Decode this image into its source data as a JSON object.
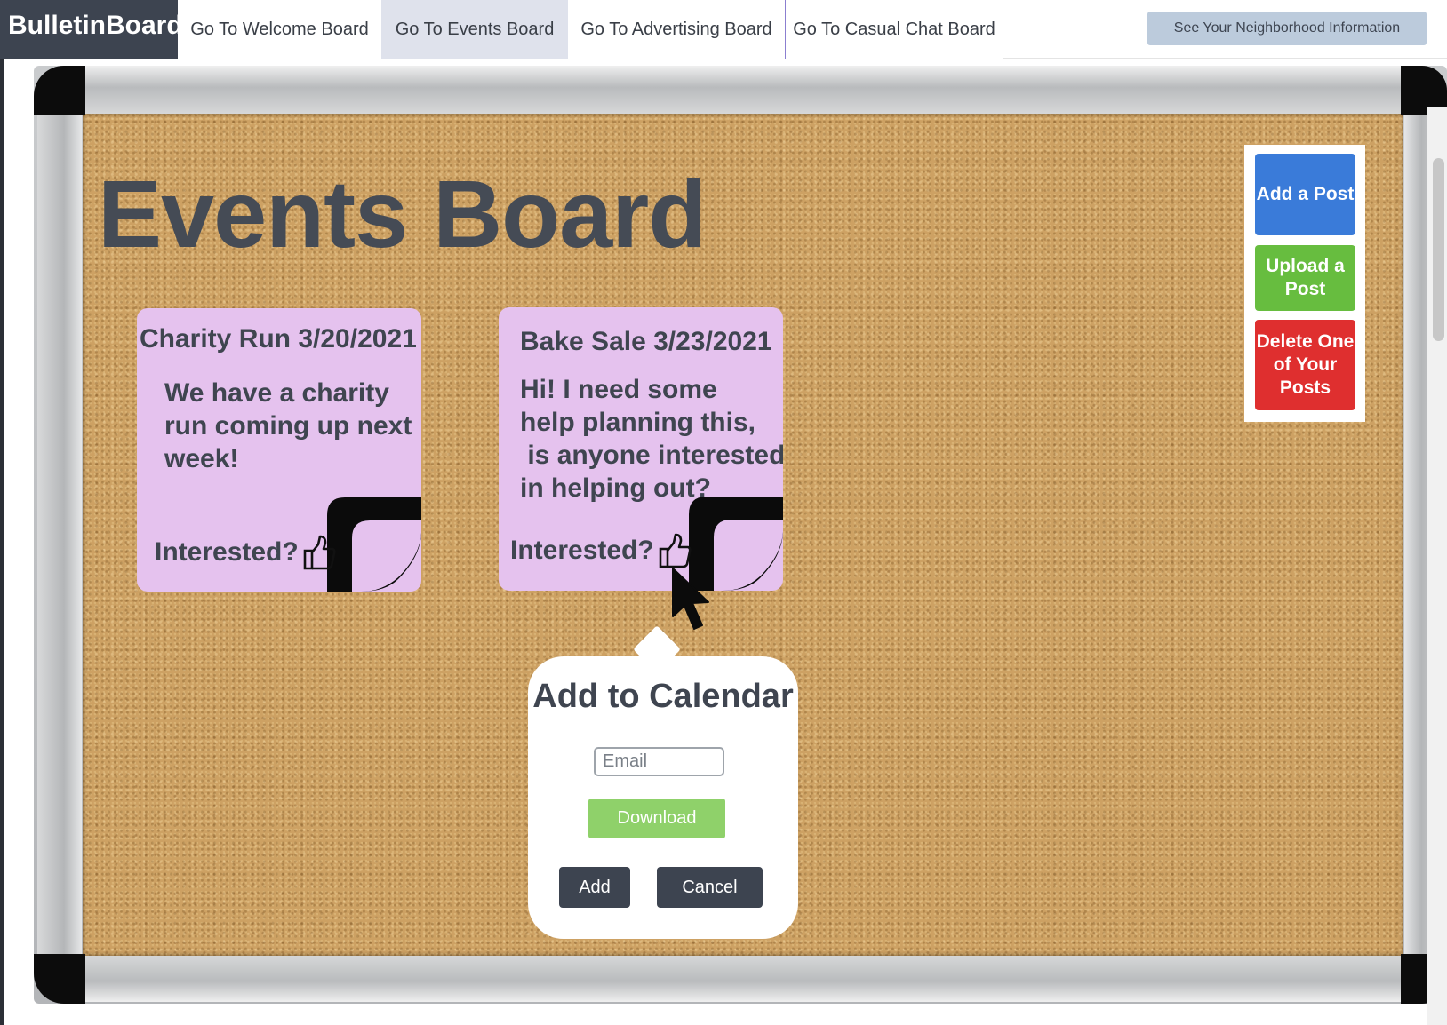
{
  "brand": "BulletinBoard",
  "nav": {
    "tabs": [
      {
        "label": "Go To Welcome Board"
      },
      {
        "label": "Go To Events Board"
      },
      {
        "label": "Go To Advertising Board"
      },
      {
        "label": "Go To Casual Chat Board"
      }
    ],
    "active_tab": "Go To Events Board",
    "neighborhood_label": "See Your Neighborhood Information"
  },
  "board": {
    "title": "Events Board",
    "notes": [
      {
        "title": "Charity Run 3/20/2021",
        "body_lines": [
          "We have a charity",
          "run coming up next",
          "week!"
        ],
        "interested_label": "Interested?"
      },
      {
        "title": "Bake Sale 3/23/2021",
        "body_lines": [
          "Hi! I need some",
          "help planning this,",
          " is anyone interested",
          "in helping out?"
        ],
        "interested_label": "Interested?"
      }
    ]
  },
  "actions": {
    "add_post": "Add a Post",
    "upload_post": "Upload a Post",
    "delete_post": "Delete One of Your Posts"
  },
  "popup": {
    "title": "Add to Calendar",
    "email_placeholder": "Email",
    "email_value": "",
    "download_label": "Download",
    "add_label": "Add",
    "cancel_label": "Cancel"
  },
  "colors": {
    "brand_bg": "#3d4450",
    "note_bg": "#e5c2ee",
    "add_post": "#3a7bd9",
    "upload_post": "#67bd3f",
    "delete_post": "#df2f2f",
    "download": "#8fd16a",
    "cork": "#cda163"
  },
  "icons": {
    "interested": "thumbs-up-icon",
    "cursor": "mouse-pointer-icon",
    "note_corner": "page-curl-icon"
  }
}
